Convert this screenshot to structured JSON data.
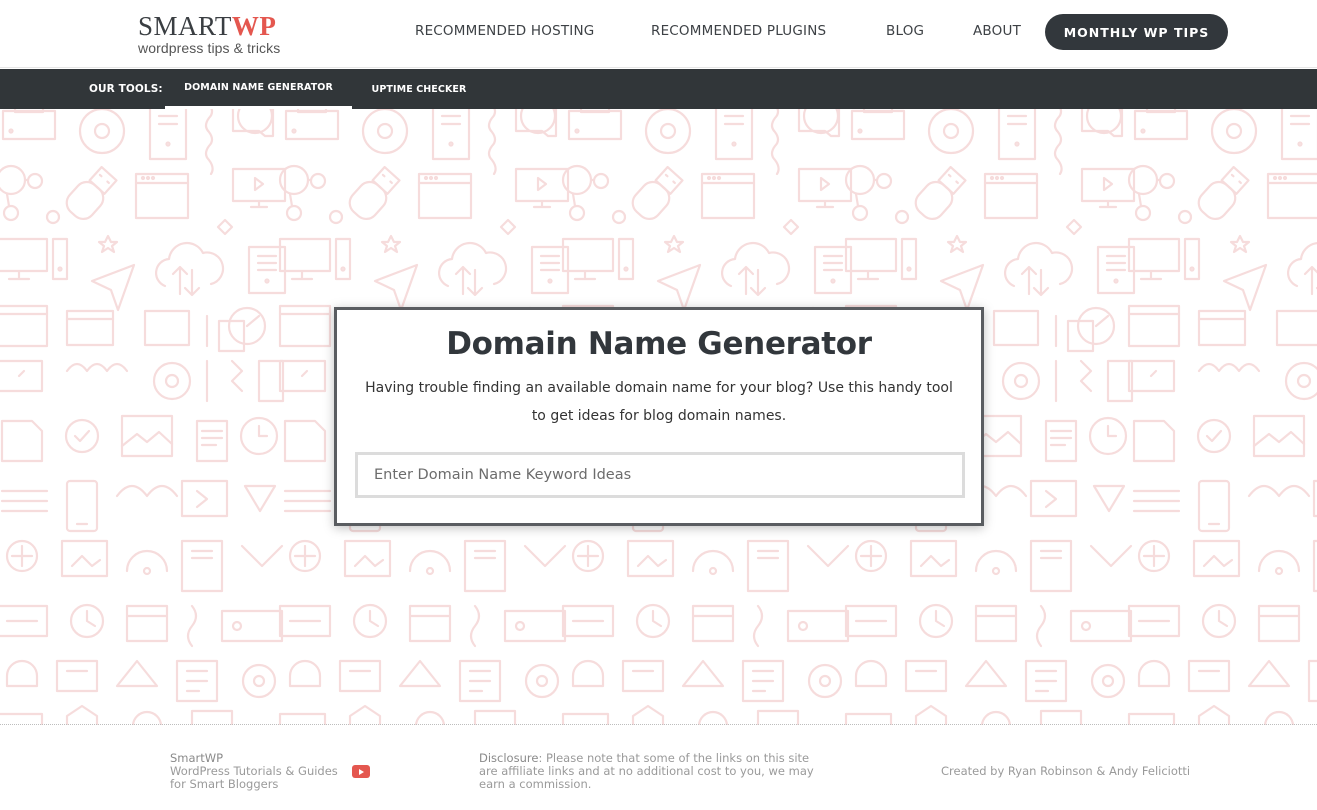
{
  "header": {
    "logo": {
      "main": "SMART",
      "accent": "WP",
      "tagline": "wordpress tips & tricks"
    },
    "nav": [
      {
        "label": "RECOMMENDED HOSTING"
      },
      {
        "label": "RECOMMENDED PLUGINS"
      },
      {
        "label": "BLOG"
      },
      {
        "label": "ABOUT"
      }
    ],
    "cta_label": "MONTHLY WP TIPS"
  },
  "tools_bar": {
    "label": "OUR TOOLS:",
    "tabs": [
      {
        "label": "DOMAIN NAME GENERATOR",
        "active": true
      },
      {
        "label": "UPTIME CHECKER",
        "active": false
      }
    ]
  },
  "card": {
    "title": "Domain Name Generator",
    "description": "Having trouble finding an available domain name for your blog? Use this handy tool to get ideas for blog domain names.",
    "input": {
      "value": "",
      "placeholder": "Enter Domain Name Keyword Ideas"
    }
  },
  "footer": {
    "left": {
      "brand": "SmartWP",
      "line2": "WordPress Tutorials & Guides",
      "line3": "for Smart Bloggers",
      "icon": "youtube-icon"
    },
    "disclosure": {
      "label": "Disclosure",
      "text": ": Please note that some of the links on this site are affiliate links and at no additional cost to you, we may earn a commission."
    },
    "credits": "Created by Ryan Robinson & Andy Feliciotti"
  },
  "colors": {
    "accent": "#e4574f",
    "dark": "#32373c",
    "pattern": "#f6dcdc"
  }
}
